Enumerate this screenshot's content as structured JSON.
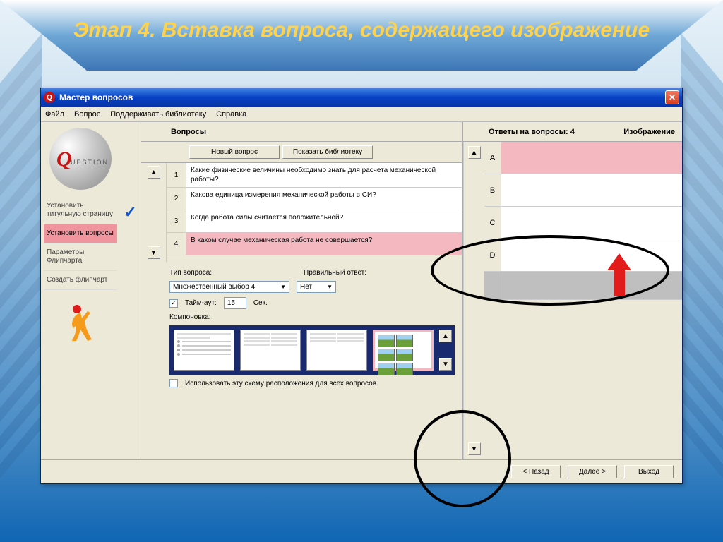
{
  "slide_title": "Этап 4. Вставка вопроса, содержащего изображение",
  "window": {
    "title": "Мастер вопросов"
  },
  "menu": {
    "file": "Файл",
    "question": "Вопрос",
    "maintain": "Поддерживать библиотеку",
    "help": "Справка"
  },
  "sidebar": {
    "items": [
      {
        "label": "Установить титульную страницу"
      },
      {
        "label": "Установить вопросы"
      },
      {
        "label": "Параметры Флипчарта"
      },
      {
        "label": "Создать флипчарт"
      }
    ]
  },
  "questions": {
    "header": "Вопросы",
    "new_btn": "Новый вопрос",
    "show_lib_btn": "Показать библиотеку",
    "rows": [
      {
        "n": "1",
        "text": "Какие физические величины необходимо знать для расчета механической работы?"
      },
      {
        "n": "2",
        "text": "Какова единица измерения  механической работы в СИ?"
      },
      {
        "n": "3",
        "text": "Когда работа силы считается положительной?"
      },
      {
        "n": "4",
        "text": "В каком случае механическая работа не совершается?"
      }
    ]
  },
  "form": {
    "type_label": "Тип вопроса:",
    "type_value": "Множественный выбор 4",
    "correct_label": "Правильный ответ:",
    "correct_value": "Нет",
    "timeout_label": "Тайм-аут:",
    "timeout_value": "15",
    "timeout_unit": "Сек.",
    "layout_label": "Компоновка:",
    "use_layout_label": "Использовать эту схему расположения для всех вопросов"
  },
  "answers": {
    "header": "Ответы на вопросы:  4",
    "image_header": "Изображение",
    "rows": [
      "A",
      "B",
      "C",
      "D"
    ]
  },
  "footer": {
    "back": "< Назад",
    "next": "Далее >",
    "exit": "Выход"
  }
}
